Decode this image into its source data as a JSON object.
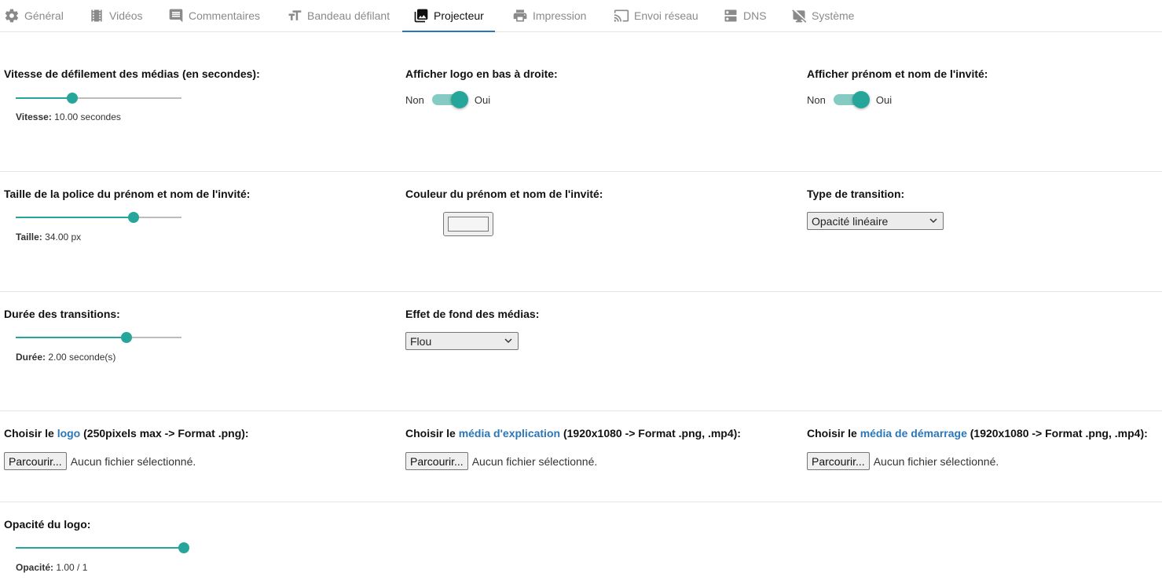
{
  "tabs": [
    {
      "label": "Général",
      "icon": "gear-icon"
    },
    {
      "label": "Vidéos",
      "icon": "film-icon"
    },
    {
      "label": "Commentaires",
      "icon": "comment-icon"
    },
    {
      "label": "Bandeau défilant",
      "icon": "text-size-icon"
    },
    {
      "label": "Projecteur",
      "icon": "photo-library-icon",
      "active": true
    },
    {
      "label": "Impression",
      "icon": "printer-icon"
    },
    {
      "label": "Envoi réseau",
      "icon": "cast-icon"
    },
    {
      "label": "DNS",
      "icon": "server-icon"
    },
    {
      "label": "Système",
      "icon": "system-off-icon"
    }
  ],
  "accent_color": "#26a69a",
  "link_color": "#2a76b8",
  "speed": {
    "label": "Vitesse de défilement des médias (en secondes):",
    "value_label": "Vitesse:",
    "value_text": "10.00 secondes",
    "fraction": 0.34
  },
  "logo_toggle": {
    "label": "Afficher logo en bas à droite:",
    "off": "Non",
    "on": "Oui",
    "checked": true
  },
  "name_toggle": {
    "label": "Afficher prénom et nom de l'invité:",
    "off": "Non",
    "on": "Oui",
    "checked": true
  },
  "font_size": {
    "label": "Taille de la police du prénom et nom de l'invité:",
    "value_label": "Taille:",
    "value_text": "34.00 px",
    "fraction": 0.71
  },
  "name_color": {
    "label": "Couleur du prénom et nom de l'invité:",
    "value": "#f5f5f5"
  },
  "transition_type": {
    "label": "Type de transition:",
    "selected": "Opacité linéaire"
  },
  "transition_duration": {
    "label": "Durée des transitions:",
    "value_label": "Durée:",
    "value_text": "2.00 seconde(s)",
    "fraction": 0.67
  },
  "background_effect": {
    "label": "Effet de fond des médias:",
    "selected": "Flou"
  },
  "logo_file": {
    "prefix": "Choisir le",
    "link": "logo",
    "suffix": "(250pixels max -> Format .png):",
    "button": "Parcourir...",
    "status": "Aucun fichier sélectionné."
  },
  "explain_file": {
    "prefix": "Choisir le",
    "link": "média d'explication",
    "suffix": "(1920x1080 -> Format .png, .mp4):",
    "button": "Parcourir...",
    "status": "Aucun fichier sélectionné."
  },
  "startup_file": {
    "prefix": "Choisir le",
    "link": "média de démarrage",
    "suffix": "(1920x1080 -> Format .png, .mp4):",
    "button": "Parcourir...",
    "status": "Aucun fichier sélectionné."
  },
  "logo_opacity": {
    "label": "Opacité du logo:",
    "value_label": "Opacité:",
    "value_text": "1.00 / 1",
    "fraction": 1.0
  }
}
